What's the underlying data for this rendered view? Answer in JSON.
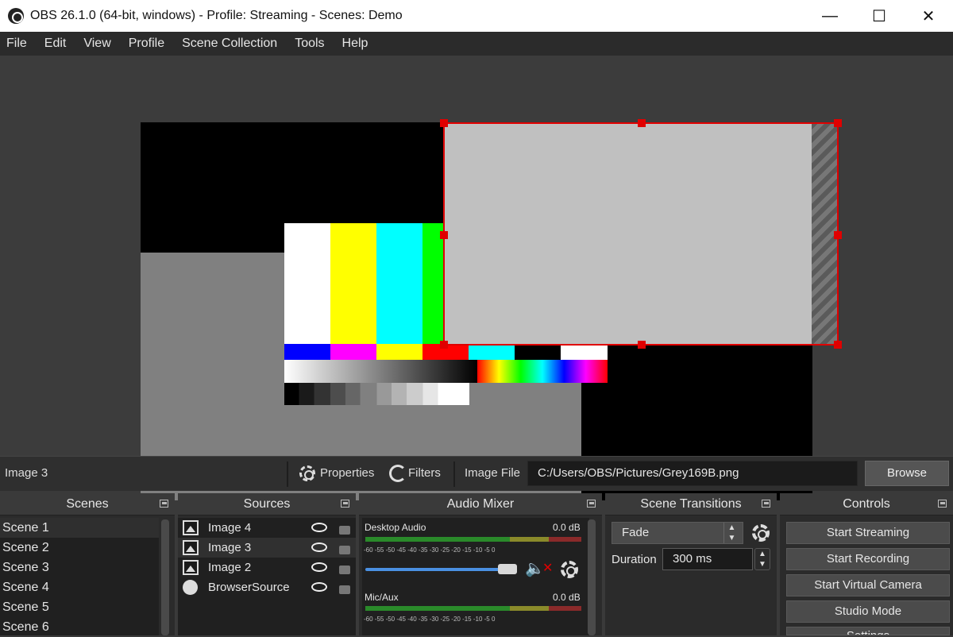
{
  "window": {
    "title": "OBS 26.1.0 (64-bit, windows) - Profile: Streaming - Scenes: Demo",
    "minimize": "—",
    "maximize": "☐",
    "close": "✕"
  },
  "menu": [
    "File",
    "Edit",
    "View",
    "Profile",
    "Scene Collection",
    "Tools",
    "Help"
  ],
  "properties_bar": {
    "selected_source": "Image 3",
    "properties_label": "Properties",
    "filters_label": "Filters",
    "image_file_label": "Image File",
    "file_path": "C:/Users/OBS/Pictures/Grey169B.png",
    "browse_label": "Browse"
  },
  "docks": {
    "scenes": {
      "title": "Scenes",
      "items": [
        "Scene 1",
        "Scene 2",
        "Scene 3",
        "Scene 4",
        "Scene 5",
        "Scene 6"
      ]
    },
    "sources": {
      "title": "Sources",
      "items": [
        {
          "name": "Image 4",
          "icon": "image-icon"
        },
        {
          "name": "Image 3",
          "icon": "image-icon"
        },
        {
          "name": "Image 2",
          "icon": "image-icon"
        },
        {
          "name": "BrowserSource",
          "icon": "globe-icon"
        }
      ]
    },
    "audio_mixer": {
      "title": "Audio Mixer",
      "channels": [
        {
          "name": "Desktop Audio",
          "level": "0.0 dB",
          "muted": true
        },
        {
          "name": "Mic/Aux",
          "level": "0.0 dB"
        }
      ],
      "scale": "-60 -55 -50 -45 -40 -35 -30 -25 -20 -15 -10 -5 0"
    },
    "scene_transitions": {
      "title": "Scene Transitions",
      "transition": "Fade",
      "duration_label": "Duration",
      "duration_value": "300 ms"
    },
    "controls": {
      "title": "Controls",
      "buttons": [
        "Start Streaming",
        "Start Recording",
        "Start Virtual Camera",
        "Studio Mode",
        "Settings"
      ]
    }
  }
}
